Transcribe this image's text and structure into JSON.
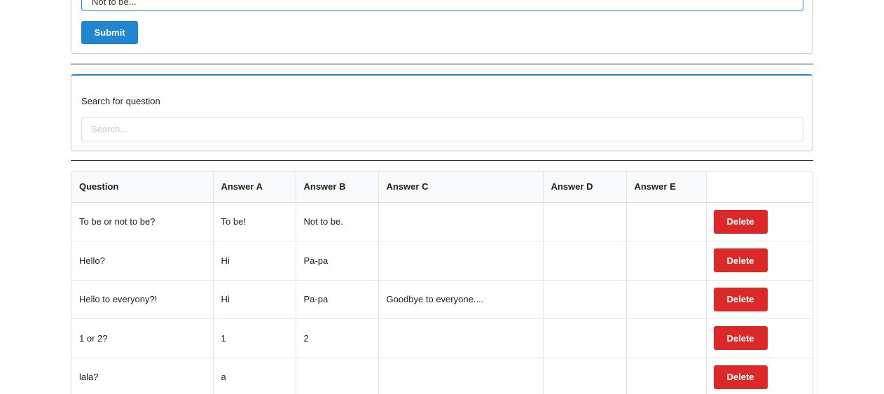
{
  "add_form": {
    "answer_value": "Not to be...",
    "submit_label": "Submit"
  },
  "search": {
    "label": "Search for question",
    "placeholder": "Search..."
  },
  "table": {
    "headers": [
      "Question",
      "Answer A",
      "Answer B",
      "Answer C",
      "Answer D",
      "Answer E"
    ],
    "delete_label": "Delete",
    "rows": [
      {
        "question": "To be or not to be?",
        "a": "To be!",
        "b": "Not to be.",
        "c": "",
        "d": "",
        "e": ""
      },
      {
        "question": "Hello?",
        "a": "Hi",
        "b": "Pa-pa",
        "c": "",
        "d": "",
        "e": ""
      },
      {
        "question": "Hello to everyony?!",
        "a": "Hi",
        "b": "Pa-pa",
        "c": "Goodbye to everyone....",
        "d": "",
        "e": ""
      },
      {
        "question": "1 or 2?",
        "a": "1",
        "b": "2",
        "c": "",
        "d": "",
        "e": ""
      },
      {
        "question": "lala?",
        "a": "a",
        "b": "",
        "c": "",
        "d": "",
        "e": ""
      }
    ]
  },
  "colors": {
    "primary": "#2185d0",
    "danger": "#db2828"
  }
}
